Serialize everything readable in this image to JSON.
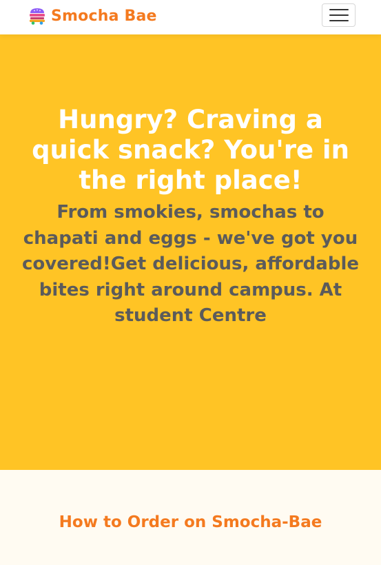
{
  "navbar": {
    "brand_name": "Smocha Bae",
    "logo_icon": "food-truck-icon",
    "menu_icon": "hamburger-menu-icon"
  },
  "hero": {
    "heading": "Hungry? Craving a quick snack? You're in the right place!",
    "subtext": "From smokies, smochas to chapati and eggs - we've got you covered!Get delicious, affordable bites right around campus. At student Centre"
  },
  "how_to_order": {
    "heading": "How to Order on Smocha-Bae"
  },
  "colors": {
    "brand_orange": "#f47a1f",
    "hero_yellow": "#ffc425",
    "page_cream": "#fffbf2",
    "subtext_gray": "#5b5b5b"
  }
}
